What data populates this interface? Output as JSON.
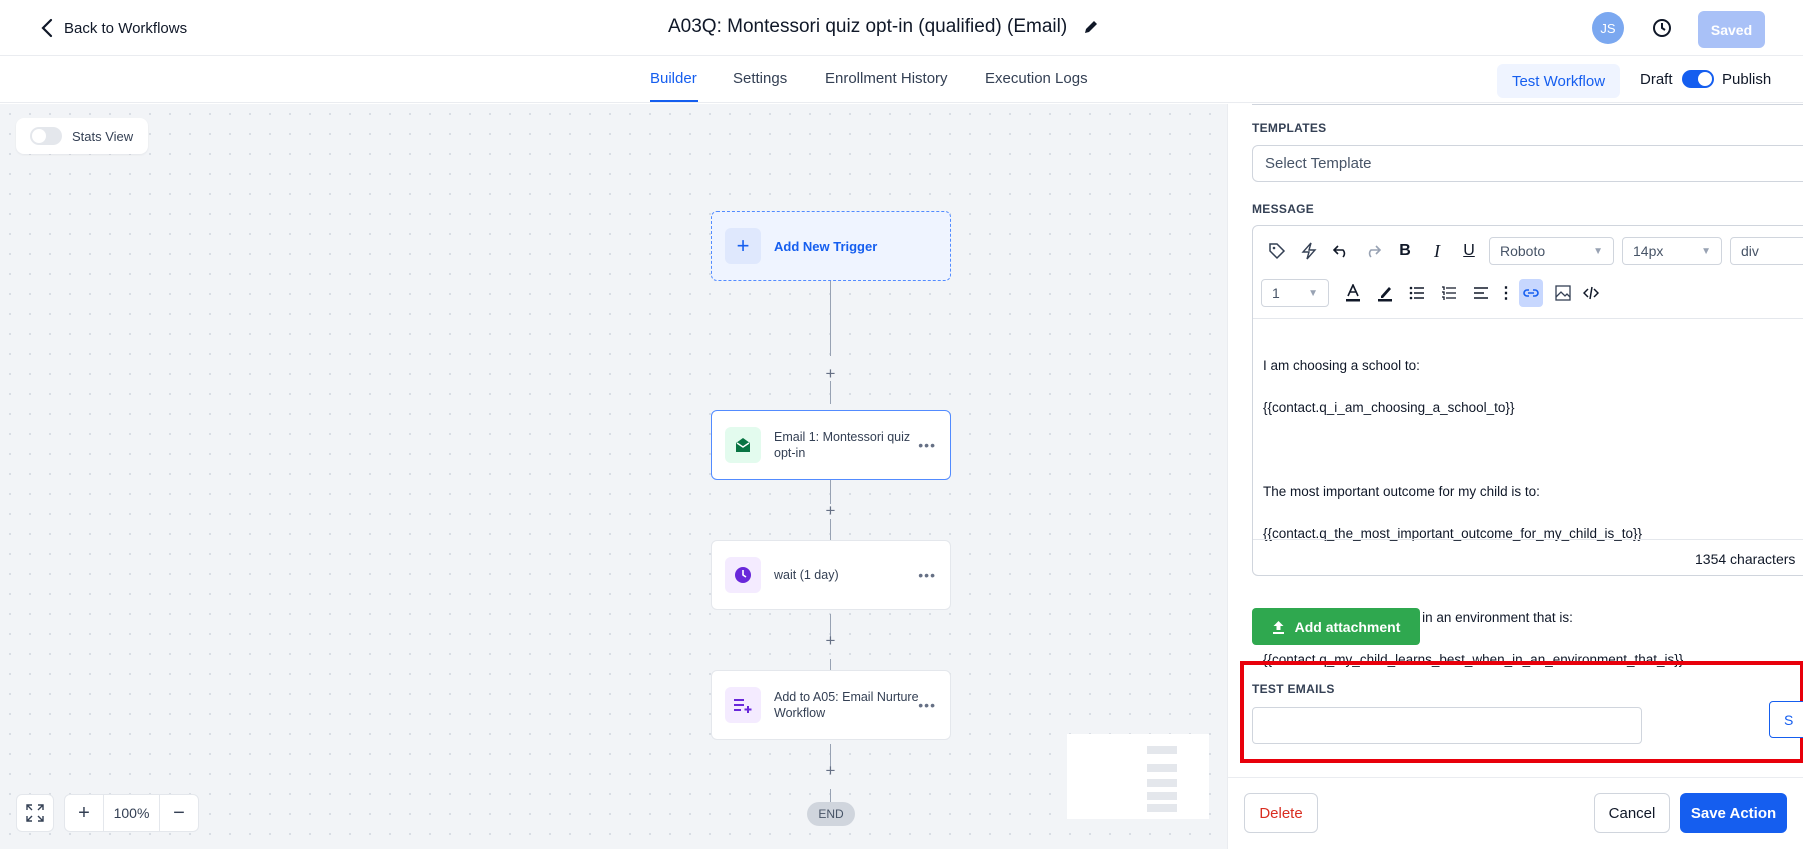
{
  "header": {
    "back_label": "Back to Workflows",
    "title": "A03Q: Montessori quiz opt-in (qualified) (Email)",
    "avatar_initials": "JS",
    "saved_label": "Saved"
  },
  "tabs": [
    {
      "label": "Builder",
      "active": true
    },
    {
      "label": "Settings",
      "active": false
    },
    {
      "label": "Enrollment History",
      "active": false
    },
    {
      "label": "Execution Logs",
      "active": false
    }
  ],
  "actions": {
    "test_workflow": "Test Workflow",
    "draft": "Draft",
    "publish": "Publish",
    "published_toggle_on": true
  },
  "canvas": {
    "stats_view": "Stats View",
    "stats_view_on": false,
    "trigger_label": "Add New Trigger",
    "nodes": [
      {
        "label": "Email 1: Montessori quiz opt-in",
        "icon": "email-icon",
        "color": "#087443"
      },
      {
        "label": "wait (1 day)",
        "icon": "clock-icon",
        "color": "#6927da"
      },
      {
        "label": "Add to A05: Email Nurture Workflow",
        "icon": "list-add-icon",
        "color": "#6927da"
      }
    ],
    "end_label": "END",
    "zoom": "100%"
  },
  "panel": {
    "templates_label": "TEMPLATES",
    "template_placeholder": "Select Template",
    "message_label": "MESSAGE",
    "font_family": "Roboto",
    "font_size": "14px",
    "block_type": "div",
    "line_height": "1",
    "body_lines": [
      "I am choosing a school to:",
      "{{contact.q_i_am_choosing_a_school_to}}",
      "",
      "The most important outcome for my child is to:",
      "{{contact.q_the_most_important_outcome_for_my_child_is_to}}",
      "",
      "My child learns best when in an environment that is:",
      "{{contact.q_my_child_learns_best_when_in_an_environment_that_is}}"
    ],
    "char_count": "1354 characters",
    "attachment_label": "Add attachment",
    "test_emails_label": "TEST EMAILS",
    "test_email_value": "",
    "send_label": "S",
    "delete_label": "Delete",
    "cancel_label": "Cancel",
    "save_label": "Save Action"
  },
  "colors": {
    "accent": "#155eef",
    "success": "#2fa84f",
    "danger": "#d92d20",
    "highlight_box": "#e8000b"
  }
}
